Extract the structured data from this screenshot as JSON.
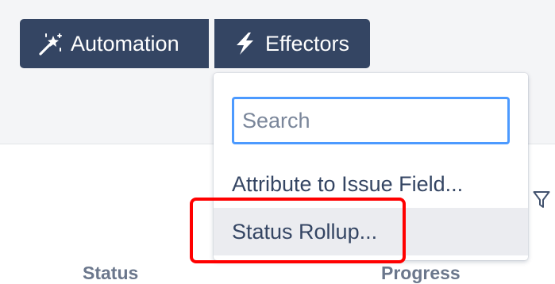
{
  "toolbar": {
    "automation_label": "Automation",
    "automation_icon": "magic-wand-icon",
    "effectors_label": "Effectors",
    "effectors_icon": "lightning-bolt-icon"
  },
  "dropdown": {
    "search_placeholder": "Search",
    "items": [
      {
        "label": "Attribute to Issue Field..."
      },
      {
        "label": "Status Rollup...",
        "hovered": true
      }
    ]
  },
  "table": {
    "columns": [
      {
        "label": "Status"
      },
      {
        "label": "Progress"
      }
    ],
    "filter_icon": "filter-icon"
  },
  "colors": {
    "button_bg": "#344563",
    "focus_border": "#4c9aff",
    "hover_bg": "#ebecf0",
    "highlight": "#ff0000",
    "header_text": "#6b778c"
  }
}
